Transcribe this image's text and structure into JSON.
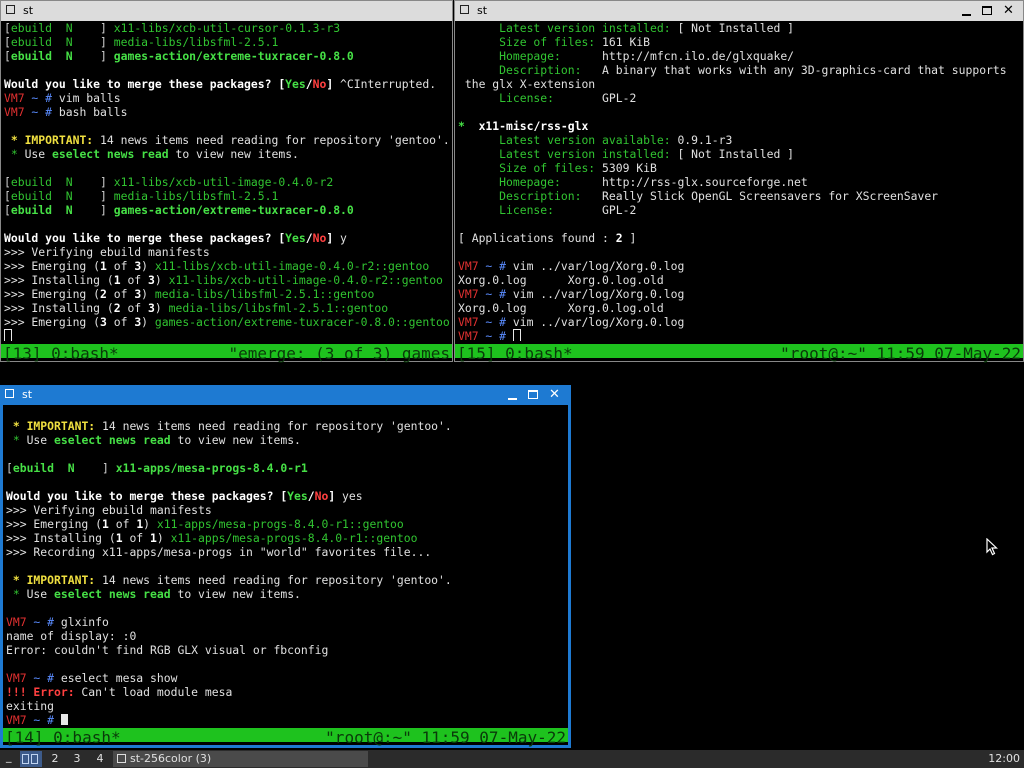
{
  "windows": [
    {
      "id": "top-left",
      "title": "st",
      "active": false,
      "lines": [
        [
          [
            "[",
            "dim"
          ],
          [
            "ebuild",
            "green"
          ],
          [
            "  N    ",
            "green"
          ],
          [
            "] ",
            "dim"
          ],
          [
            "x11-libs/xcb-util-cursor-0.1.3-r3",
            "green"
          ]
        ],
        [
          [
            "[",
            "dim"
          ],
          [
            "ebuild",
            "green"
          ],
          [
            "  N    ",
            "green"
          ],
          [
            "] ",
            "dim"
          ],
          [
            "media-libs/libsfml-2.5.1",
            "green"
          ]
        ],
        [
          [
            "[",
            "dim"
          ],
          [
            "ebuild",
            "bgreen"
          ],
          [
            "  N    ",
            "bgreen"
          ],
          [
            "] ",
            "dim"
          ],
          [
            "games-action/extreme-tuxracer-0.8.0",
            "bgreen"
          ]
        ],
        [
          [
            "",
            ""
          ]
        ],
        [
          [
            "Would you like to merge these packages? ",
            "bold"
          ],
          [
            "[",
            "bold"
          ],
          [
            "Yes",
            "bgreen"
          ],
          [
            "/",
            "bold"
          ],
          [
            "No",
            "bred"
          ],
          [
            "] ",
            "bold"
          ],
          [
            "^CInterrupted.",
            ""
          ]
        ],
        [
          [
            "VM7",
            "red"
          ],
          [
            " ~ # ",
            "blue"
          ],
          [
            "vim balls",
            ""
          ]
        ],
        [
          [
            "VM7",
            "red"
          ],
          [
            " ~ # ",
            "blue"
          ],
          [
            "bash balls",
            ""
          ]
        ],
        [
          [
            "",
            ""
          ]
        ],
        [
          [
            " * ",
            "yel"
          ],
          [
            "IMPORTANT:",
            "yel"
          ],
          [
            " 14 news items need reading for repository 'gentoo'.",
            ""
          ]
        ],
        [
          [
            " * ",
            "green"
          ],
          [
            "Use ",
            ""
          ],
          [
            "eselect news read",
            "bgreen"
          ],
          [
            " to view new items.",
            ""
          ]
        ],
        [
          [
            "",
            ""
          ]
        ],
        [
          [
            "[",
            "dim"
          ],
          [
            "ebuild",
            "green"
          ],
          [
            "  N    ",
            "green"
          ],
          [
            "] ",
            "dim"
          ],
          [
            "x11-libs/xcb-util-image-0.4.0-r2",
            "green"
          ]
        ],
        [
          [
            "[",
            "dim"
          ],
          [
            "ebuild",
            "green"
          ],
          [
            "  N    ",
            "green"
          ],
          [
            "] ",
            "dim"
          ],
          [
            "media-libs/libsfml-2.5.1",
            "green"
          ]
        ],
        [
          [
            "[",
            "dim"
          ],
          [
            "ebuild",
            "bgreen"
          ],
          [
            "  N    ",
            "bgreen"
          ],
          [
            "] ",
            "dim"
          ],
          [
            "games-action/extreme-tuxracer-0.8.0",
            "bgreen"
          ]
        ],
        [
          [
            "",
            ""
          ]
        ],
        [
          [
            "Would you like to merge these packages? ",
            "bold"
          ],
          [
            "[",
            "bold"
          ],
          [
            "Yes",
            "bgreen"
          ],
          [
            "/",
            "bold"
          ],
          [
            "No",
            "bred"
          ],
          [
            "] ",
            "bold"
          ],
          [
            "y",
            ""
          ]
        ],
        [
          [
            ">>> Verifying ebuild manifests",
            ""
          ]
        ],
        [
          [
            ">>> Emerging (",
            ""
          ],
          [
            "1",
            "bold"
          ],
          [
            " of ",
            ""
          ],
          [
            "3",
            "bold"
          ],
          [
            ") ",
            ""
          ],
          [
            "x11-libs/xcb-util-image-0.4.0-r2::gentoo",
            "green"
          ]
        ],
        [
          [
            ">>> Installing (",
            ""
          ],
          [
            "1",
            "bold"
          ],
          [
            " of ",
            ""
          ],
          [
            "3",
            "bold"
          ],
          [
            ") ",
            ""
          ],
          [
            "x11-libs/xcb-util-image-0.4.0-r2::gentoo",
            "green"
          ]
        ],
        [
          [
            ">>> Emerging (",
            ""
          ],
          [
            "2",
            "bold"
          ],
          [
            " of ",
            ""
          ],
          [
            "3",
            "bold"
          ],
          [
            ") ",
            ""
          ],
          [
            "media-libs/libsfml-2.5.1::gentoo",
            "green"
          ]
        ],
        [
          [
            ">>> Installing (",
            ""
          ],
          [
            "2",
            "bold"
          ],
          [
            " of ",
            ""
          ],
          [
            "3",
            "bold"
          ],
          [
            ") ",
            ""
          ],
          [
            "media-libs/libsfml-2.5.1::gentoo",
            "green"
          ]
        ],
        [
          [
            ">>> Emerging (",
            ""
          ],
          [
            "3",
            "bold"
          ],
          [
            " of ",
            ""
          ],
          [
            "3",
            "bold"
          ],
          [
            ") ",
            ""
          ],
          [
            "games-action/extreme-tuxracer-0.8.0::gentoo",
            "green"
          ]
        ],
        [
          [
            "",
            ""
          ]
        ]
      ],
      "cursor": "hollow",
      "status_left": "[13] 0:bash*",
      "status_right": "\"emerge: (3 of 3) games"
    },
    {
      "id": "top-right",
      "title": "st",
      "active": false,
      "lines": [
        [
          [
            "      Latest version installed: ",
            "green"
          ],
          [
            "[ Not Installed ]",
            ""
          ]
        ],
        [
          [
            "      Size of files: ",
            "green"
          ],
          [
            "161 KiB",
            ""
          ]
        ],
        [
          [
            "      Homepage:      ",
            "green"
          ],
          [
            "http://mfcn.ilo.de/glxquake/",
            ""
          ]
        ],
        [
          [
            "      Description:   ",
            "green"
          ],
          [
            "A binary that works with any 3D-graphics-card that supports",
            ""
          ]
        ],
        [
          [
            " the glx X-extension",
            ""
          ]
        ],
        [
          [
            "      License:       ",
            "green"
          ],
          [
            "GPL-2",
            ""
          ]
        ],
        [
          [
            "",
            ""
          ]
        ],
        [
          [
            "*  ",
            "bgreen"
          ],
          [
            "x11-misc/rss-glx",
            "bold"
          ]
        ],
        [
          [
            "      Latest version available: ",
            "green"
          ],
          [
            "0.9.1-r3",
            ""
          ]
        ],
        [
          [
            "      Latest version installed: ",
            "green"
          ],
          [
            "[ Not Installed ]",
            ""
          ]
        ],
        [
          [
            "      Size of files: ",
            "green"
          ],
          [
            "5309 KiB",
            ""
          ]
        ],
        [
          [
            "      Homepage:      ",
            "green"
          ],
          [
            "http://rss-glx.sourceforge.net",
            ""
          ]
        ],
        [
          [
            "      Description:   ",
            "green"
          ],
          [
            "Really Slick OpenGL Screensavers for XScreenSaver",
            ""
          ]
        ],
        [
          [
            "      License:       ",
            "green"
          ],
          [
            "GPL-2",
            ""
          ]
        ],
        [
          [
            "",
            ""
          ]
        ],
        [
          [
            "[ Applications found : ",
            ""
          ],
          [
            "2",
            "bold"
          ],
          [
            " ]",
            ""
          ]
        ],
        [
          [
            "",
            ""
          ]
        ],
        [
          [
            "VM7",
            "red"
          ],
          [
            " ~ # ",
            "blue"
          ],
          [
            "vim ../var/log/Xorg.0.log",
            ""
          ]
        ],
        [
          [
            "Xorg.0.log      Xorg.0.log.old",
            ""
          ]
        ],
        [
          [
            "VM7",
            "red"
          ],
          [
            " ~ # ",
            "blue"
          ],
          [
            "vim ../var/log/Xorg.0.log",
            ""
          ]
        ],
        [
          [
            "Xorg.0.log      Xorg.0.log.old",
            ""
          ]
        ],
        [
          [
            "VM7",
            "red"
          ],
          [
            " ~ # ",
            "blue"
          ],
          [
            "vim ../var/log/Xorg.0.log",
            ""
          ]
        ],
        [
          [
            "VM7",
            "red"
          ],
          [
            " ~ # ",
            "blue"
          ]
        ]
      ],
      "cursor": "hollow",
      "status_left": "[15] 0:bash*",
      "status_right": "\"root@:~\" 11:59 07-May-22"
    },
    {
      "id": "bottom",
      "title": "st",
      "active": true,
      "lines": [
        [
          [
            "",
            ""
          ]
        ],
        [
          [
            " * ",
            "yel"
          ],
          [
            "IMPORTANT:",
            "yel"
          ],
          [
            " 14 news items need reading for repository 'gentoo'.",
            ""
          ]
        ],
        [
          [
            " * ",
            "green"
          ],
          [
            "Use ",
            ""
          ],
          [
            "eselect news read",
            "bgreen"
          ],
          [
            " to view new items.",
            ""
          ]
        ],
        [
          [
            "",
            ""
          ]
        ],
        [
          [
            "[",
            "dim"
          ],
          [
            "ebuild",
            "bgreen"
          ],
          [
            "  N    ",
            "bgreen"
          ],
          [
            "] ",
            "dim"
          ],
          [
            "x11-apps/mesa-progs-8.4.0-r1",
            "bgreen"
          ]
        ],
        [
          [
            "",
            ""
          ]
        ],
        [
          [
            "Would you like to merge these packages? ",
            "bold"
          ],
          [
            "[",
            "bold"
          ],
          [
            "Yes",
            "bgreen"
          ],
          [
            "/",
            "bold"
          ],
          [
            "No",
            "bred"
          ],
          [
            "] ",
            "bold"
          ],
          [
            "yes",
            ""
          ]
        ],
        [
          [
            ">>> Verifying ebuild manifests",
            ""
          ]
        ],
        [
          [
            ">>> Emerging (",
            ""
          ],
          [
            "1",
            "bold"
          ],
          [
            " of ",
            ""
          ],
          [
            "1",
            "bold"
          ],
          [
            ") ",
            ""
          ],
          [
            "x11-apps/mesa-progs-8.4.0-r1::gentoo",
            "green"
          ]
        ],
        [
          [
            ">>> Installing (",
            ""
          ],
          [
            "1",
            "bold"
          ],
          [
            " of ",
            ""
          ],
          [
            "1",
            "bold"
          ],
          [
            ") ",
            ""
          ],
          [
            "x11-apps/mesa-progs-8.4.0-r1::gentoo",
            "green"
          ]
        ],
        [
          [
            ">>> Recording x11-apps/mesa-progs in \"world\" favorites file...",
            ""
          ]
        ],
        [
          [
            "",
            ""
          ]
        ],
        [
          [
            " * ",
            "yel"
          ],
          [
            "IMPORTANT:",
            "yel"
          ],
          [
            " 14 news items need reading for repository 'gentoo'.",
            ""
          ]
        ],
        [
          [
            " * ",
            "green"
          ],
          [
            "Use ",
            ""
          ],
          [
            "eselect news read",
            "bgreen"
          ],
          [
            " to view new items.",
            ""
          ]
        ],
        [
          [
            "",
            ""
          ]
        ],
        [
          [
            "VM7",
            "red"
          ],
          [
            " ~ # ",
            "blue"
          ],
          [
            "glxinfo",
            ""
          ]
        ],
        [
          [
            "name of display: :0",
            ""
          ]
        ],
        [
          [
            "Error: couldn't find RGB GLX visual or fbconfig",
            ""
          ]
        ],
        [
          [
            "",
            ""
          ]
        ],
        [
          [
            "VM7",
            "red"
          ],
          [
            " ~ # ",
            "blue"
          ],
          [
            "eselect mesa show",
            ""
          ]
        ],
        [
          [
            "!!! Error:",
            "bred"
          ],
          [
            " Can't load module mesa",
            ""
          ]
        ],
        [
          [
            "exiting",
            ""
          ]
        ],
        [
          [
            "VM7",
            "red"
          ],
          [
            " ~ # ",
            "blue"
          ]
        ]
      ],
      "cursor": "block",
      "status_left": "[14] 0:bash*",
      "status_right": "\"root@:~\" 11:59 07-May-22"
    }
  ],
  "taskbar": {
    "desktops": [
      "2",
      "3",
      "4"
    ],
    "task_label": "st-256color (3)",
    "clock": "12:00"
  },
  "icons": {
    "window_icon": "window-square-icon",
    "minimize": "minimize-icon",
    "maximize": "maximize-icon",
    "close": "close-icon",
    "mouse": "mouse-pointer-icon"
  }
}
